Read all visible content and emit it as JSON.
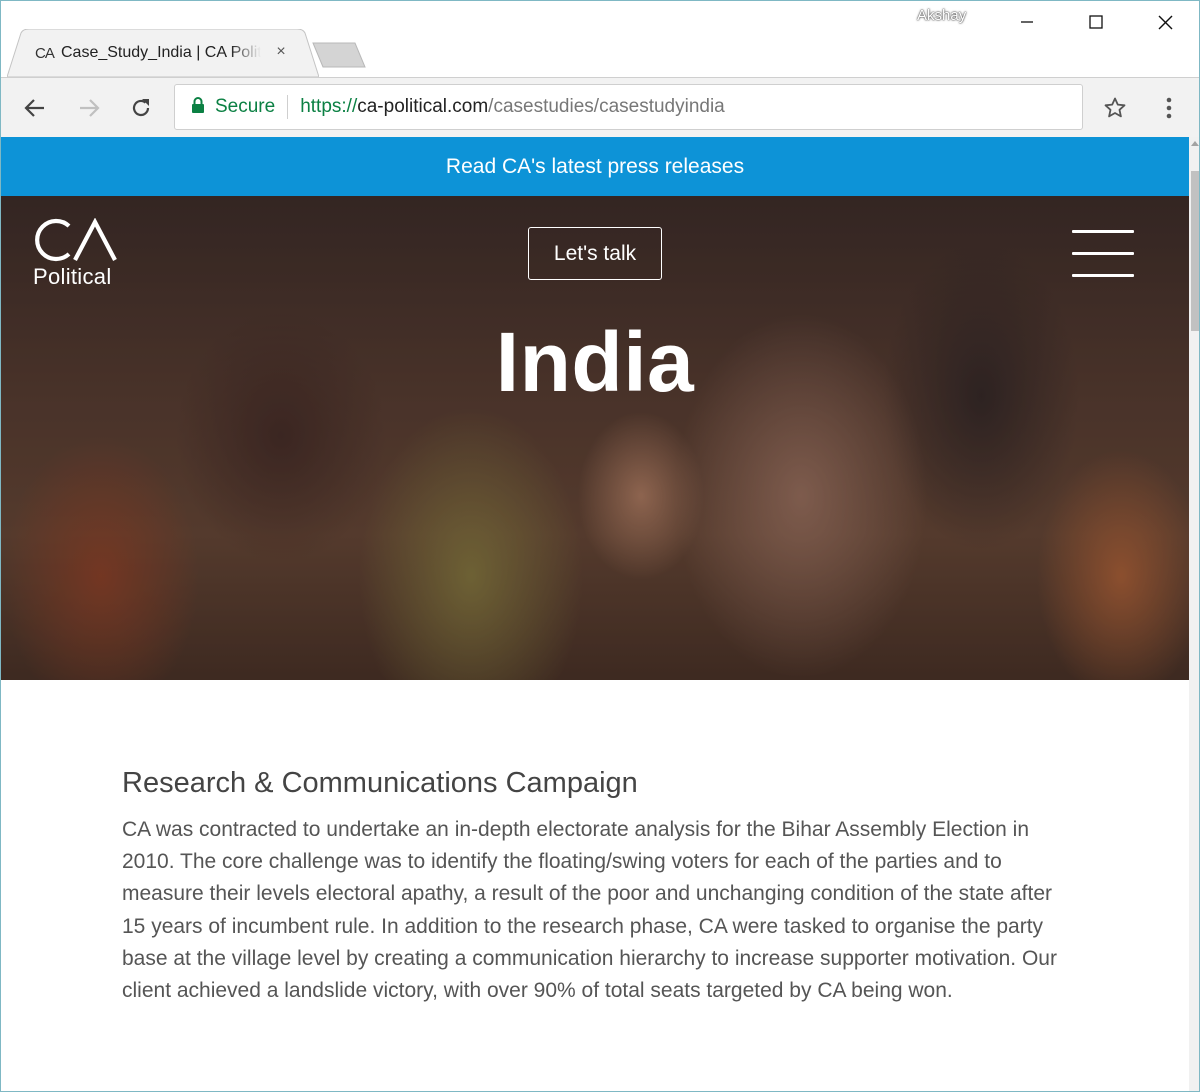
{
  "browser": {
    "tab": {
      "favicon_text": "CA",
      "title": "Case_Study_India | CA Political",
      "close_label": "×"
    },
    "user_name": "Akshay",
    "window_controls": {
      "minimize": "minimize-icon",
      "maximize": "maximize-icon",
      "close": "close-icon"
    },
    "toolbar": {
      "secure_label": "Secure",
      "url_scheme": "https://",
      "url_host": "ca-political.com",
      "url_path": "/casestudies/casestudyindia"
    },
    "icons": [
      "back-arrow-icon",
      "forward-arrow-icon",
      "reload-icon",
      "lock-icon",
      "star-icon",
      "more-vert-icon"
    ],
    "colors": {
      "secure_green": "#0b8043",
      "toolbar_bg": "#f2f2f2"
    }
  },
  "page": {
    "banner": {
      "text": "Read CA's latest press releases",
      "bg_color": "#0d93d7"
    },
    "header": {
      "logo_mark": "CA",
      "logo_text": "Political",
      "cta_label": "Let's talk",
      "menu_icon": "hamburger-menu-icon"
    },
    "hero": {
      "title": "India"
    },
    "section": {
      "heading": "Research & Communications Campaign",
      "body": "CA was contracted to undertake an in-depth electorate analysis for the Bihar Assembly Election in 2010. The core challenge was to identify the floating/swing voters for each of the parties and to measure their levels electoral apathy, a result of the poor and unchanging condition of the state after 15 years of incumbent rule. In addition to the research phase, CA were tasked to organise the party base at the village level by creating a communication hierarchy to increase supporter motivation. Our client achieved a landslide victory, with over 90% of total seats targeted by CA being won."
    }
  }
}
